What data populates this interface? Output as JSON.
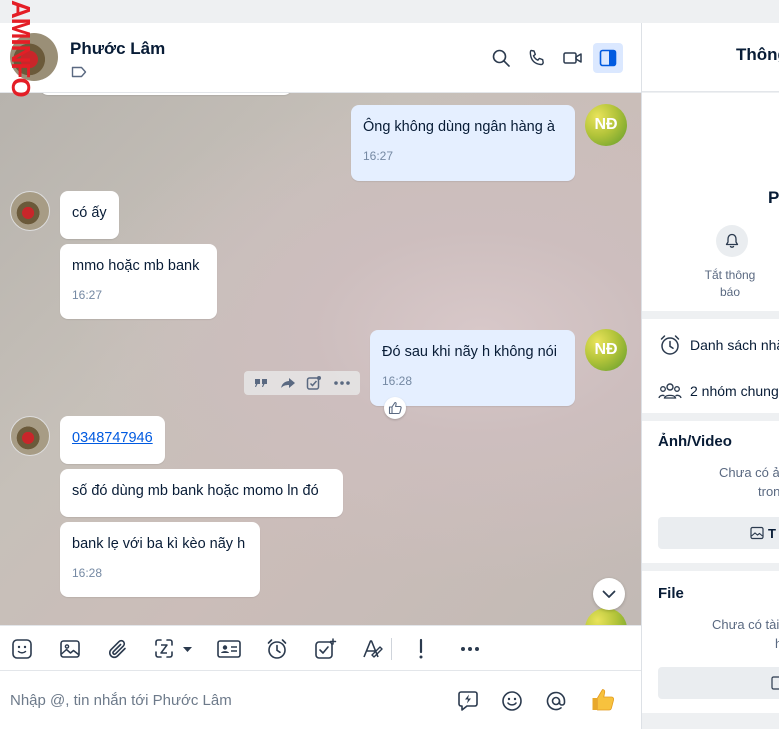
{
  "watermark": "AMINFO",
  "header": {
    "contact_name": "Phước Lâm"
  },
  "messages": {
    "m1": {
      "text": "Ông không dùng ngân hàng à",
      "time": "16:27",
      "sender_initials": "NĐ"
    },
    "m2": {
      "text": "có ấy"
    },
    "m3": {
      "text": "mmo hoặc mb bank",
      "time": "16:27"
    },
    "m4": {
      "text": "Đó sau khi nãy h không nói",
      "time": "16:28",
      "sender_initials": "NĐ"
    },
    "m5": {
      "text": "0348747946"
    },
    "m6": {
      "text": "số đó dùng mb bank hoặc momo ln đó"
    },
    "m7": {
      "text": "bank lẹ với ba kì kèo nãy h",
      "time": "16:28"
    }
  },
  "composer": {
    "placeholder": "Nhập @, tin nhắn tới Phước Lâm"
  },
  "info_panel": {
    "title": "Thông",
    "name_initial": "P",
    "mute_label": "Tắt thông báo",
    "reminders": "Danh sách nhắ",
    "groups": "2 nhóm chung",
    "media": {
      "heading": "Ảnh/Video",
      "empty_line1": "Chưa có ả",
      "empty_line2": "tron",
      "button": "T"
    },
    "file": {
      "heading": "File",
      "empty_line1": "Chưa có tài",
      "empty_line2": "h"
    }
  },
  "colors": {
    "accent": "#005ae0",
    "outgoing_bubble": "#e5efff",
    "incoming_bubble": "#ffffff",
    "watermark": "#e41e26"
  }
}
